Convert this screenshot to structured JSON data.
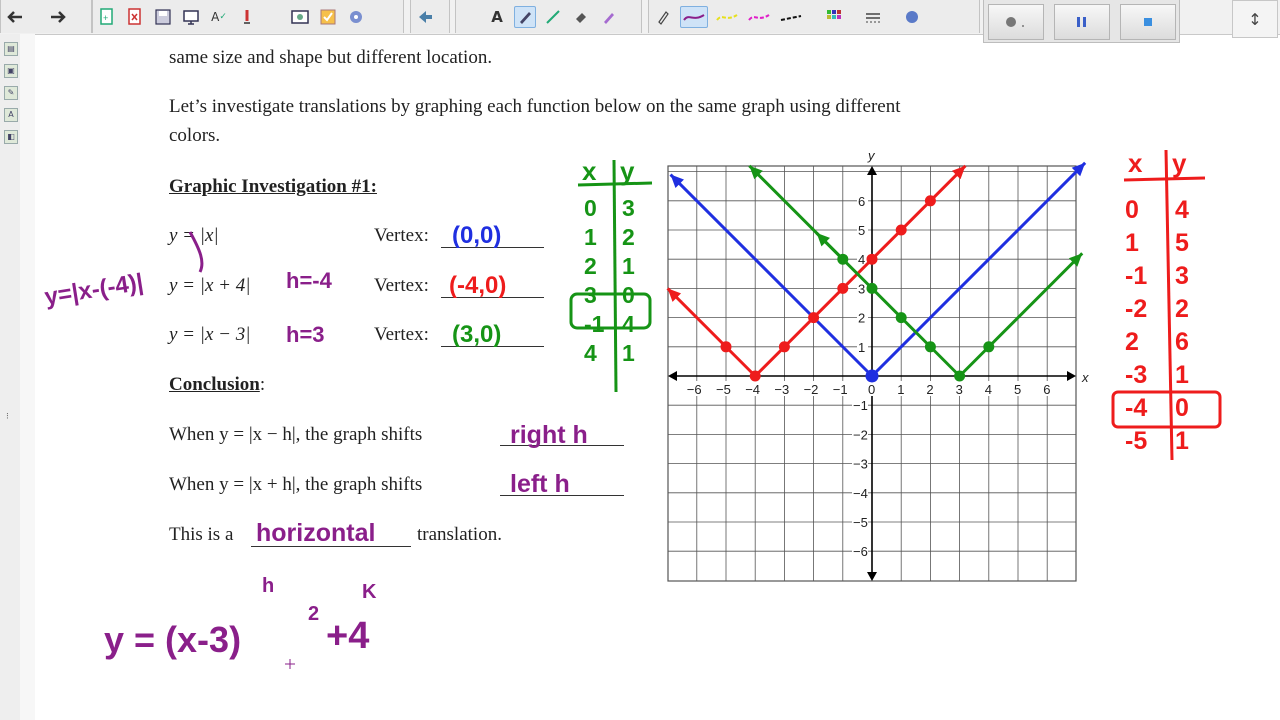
{
  "toolbar": {
    "nav": [
      "back-arrow",
      "forward-arrow"
    ],
    "tools": [
      "new-page-icon",
      "delete-page-icon",
      "save-icon",
      "screen-shade-icon",
      "spell-check-icon",
      "pen-dropper-icon",
      "capture-icon",
      "check-icon",
      "add-ons-icon"
    ],
    "text_tool": "A",
    "dock_buttons": [
      "record",
      "pause",
      "stop"
    ],
    "expand": "↕"
  },
  "worksheet": {
    "line1": "same size and shape but different location.",
    "line2": "Let’s investigate translations by graphing each function below on the same graph using different",
    "line3": "colors.",
    "heading": "Graphic Investigation #1:",
    "rows": [
      {
        "func": "y = |x|",
        "vertex_label": "Vertex:"
      },
      {
        "func": "y = |x + 4|",
        "vertex_label": "Vertex:"
      },
      {
        "func": "y = |x − 3|",
        "vertex_label": "Vertex:"
      }
    ],
    "conclusion_label": "Conclusion",
    "conclusion_colon": ":",
    "when1": "When y = |x − h|, the graph shifts",
    "when2": "When y = |x + h|, the graph shifts",
    "this_is": "This is a",
    "translation": "translation."
  },
  "handwriting": {
    "vertex1": "(0,0)",
    "vertex2": "(-4,0)",
    "vertex3": "(3,0)",
    "h_note1": "h=-4",
    "h_note2": "h=3",
    "rewrite": "y=|x-(-4)|",
    "answer1": "right h",
    "answer2": "left h",
    "answer3": "horizontal",
    "formula": "y = (x-3)",
    "exponent": "2",
    "plus_k": "+4",
    "h_label": "h",
    "k_label": "K"
  },
  "green_table": {
    "headers": [
      "x",
      "y"
    ],
    "rows": [
      [
        "0",
        "3"
      ],
      [
        "1",
        "2"
      ],
      [
        "2",
        "1"
      ],
      [
        "3",
        "0"
      ],
      [
        "-1",
        "4"
      ],
      [
        "4",
        "1"
      ]
    ]
  },
  "red_table": {
    "headers": [
      "x",
      "y"
    ],
    "rows": [
      [
        "0",
        "4"
      ],
      [
        "1",
        "5"
      ],
      [
        "-1",
        "3"
      ],
      [
        "-2",
        "2"
      ],
      [
        "2",
        "6"
      ],
      [
        "-3",
        "1"
      ],
      [
        "-4",
        "0"
      ],
      [
        "-5",
        "1"
      ]
    ]
  },
  "graph": {
    "x_axis_label": "x",
    "y_axis_label": "y",
    "x_ticks": [
      "−6",
      "−5",
      "−4",
      "−3",
      "−2",
      "−1",
      "0",
      "1",
      "2",
      "3",
      "4",
      "5",
      "6"
    ],
    "y_ticks_pos": [
      "1",
      "2",
      "3",
      "4",
      "5",
      "6"
    ],
    "y_ticks_neg": [
      "−1",
      "−2",
      "−3",
      "−4",
      "−5",
      "−6"
    ],
    "colors": {
      "blue": "#1f2fe0",
      "red": "#ee1c1c",
      "green": "#169416",
      "purple": "#8a1f8a",
      "grid": "#555555"
    },
    "blue_points": [
      [
        0,
        0
      ]
    ],
    "red_points": [
      [
        -5,
        1
      ],
      [
        -4,
        0
      ],
      [
        -3,
        1
      ],
      [
        -2,
        2
      ],
      [
        -1,
        3
      ],
      [
        0,
        4
      ],
      [
        1,
        5
      ],
      [
        2,
        6
      ]
    ],
    "green_points": [
      [
        -1,
        4
      ],
      [
        0,
        3
      ],
      [
        1,
        2
      ],
      [
        2,
        1
      ],
      [
        3,
        0
      ],
      [
        4,
        1
      ]
    ]
  },
  "colors": {
    "handwriting_blue": "#1f2fe0",
    "handwriting_red": "#ee1c1c",
    "handwriting_green": "#169416",
    "handwriting_purple": "#8a1f8a",
    "toolbar": "#f1f1f1"
  }
}
